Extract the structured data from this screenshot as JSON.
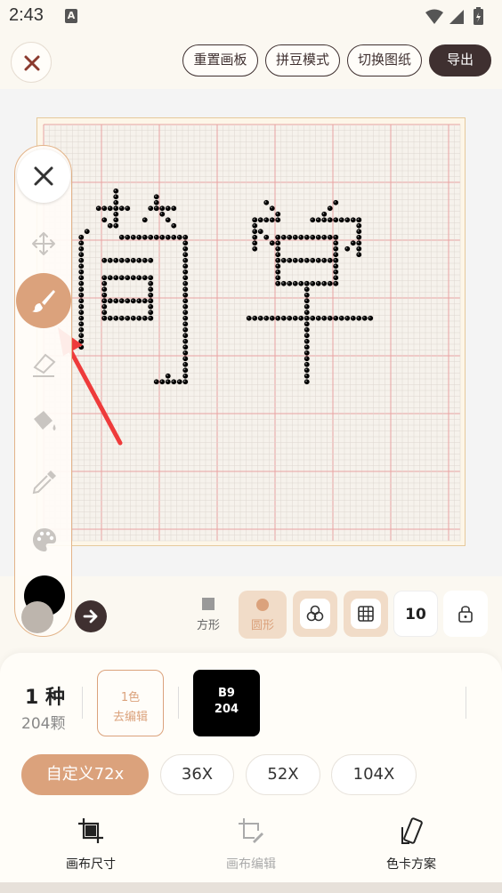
{
  "status_bar": {
    "time": "2:43",
    "notification_badge": "A"
  },
  "header": {
    "close_icon": "close-icon",
    "buttons": [
      {
        "label": "重置画板"
      },
      {
        "label": "拼豆模式"
      },
      {
        "label": "切换图纸"
      },
      {
        "label": "导出"
      }
    ]
  },
  "canvas": {
    "grid_size": 72,
    "artwork_description": "bead pattern of two characters",
    "bead_color": "#000000"
  },
  "toolbar": {
    "tools": [
      "close-icon",
      "move-icon",
      "brush-icon",
      "eraser-icon",
      "fill-bucket-icon",
      "eyedropper-icon",
      "palette-icon"
    ],
    "active_tool": "brush-icon",
    "active_color_code": "B9",
    "accent_color": "#dba27c"
  },
  "controls": {
    "modes": [
      {
        "label": "方形"
      },
      {
        "label": "圆形"
      }
    ],
    "active_mode": "圆形",
    "number_value": "10"
  },
  "summary": {
    "kinds": "1 种",
    "beads": "204颗",
    "edit_line1": "1色",
    "edit_line2": "去编辑",
    "swatch_code": "B9",
    "swatch_count": "204"
  },
  "sizes": [
    {
      "label": "自定义72x"
    },
    {
      "label": "36X"
    },
    {
      "label": "52X"
    },
    {
      "label": "104X"
    }
  ],
  "bottom_nav": [
    {
      "label": "画布尺寸"
    },
    {
      "label": "画布编辑"
    },
    {
      "label": "色卡方案"
    }
  ]
}
